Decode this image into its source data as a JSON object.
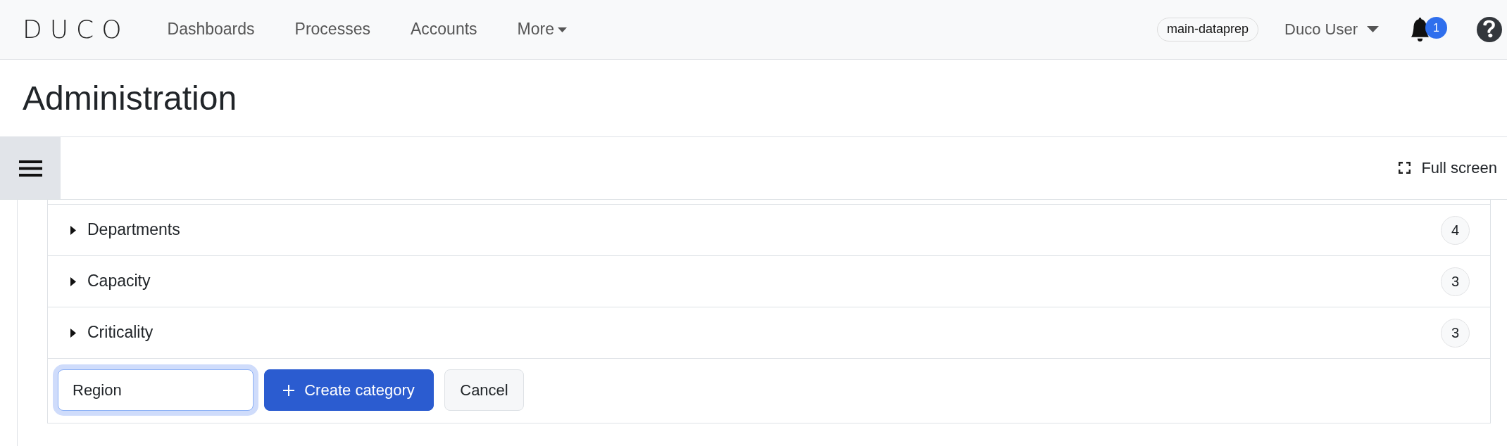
{
  "navbar": {
    "logo": "DUCO",
    "links": [
      {
        "label": "Dashboards",
        "kind": "link"
      },
      {
        "label": "Processes",
        "kind": "link"
      },
      {
        "label": "Accounts",
        "kind": "link"
      },
      {
        "label": "More",
        "kind": "dropdown"
      }
    ],
    "environment": "main-dataprep",
    "user": "Duco User",
    "notifications": "1"
  },
  "page": {
    "title": "Administration"
  },
  "toolbar": {
    "full_screen": "Full screen"
  },
  "categories": [
    {
      "name": "Departments",
      "count": "4",
      "expanded": false
    },
    {
      "name": "Capacity",
      "count": "3",
      "expanded": false
    },
    {
      "name": "Criticality",
      "count": "3",
      "expanded": false
    }
  ],
  "new_category": {
    "value": "Region",
    "focused": true,
    "create_button": "Create category",
    "cancel_button": "Cancel"
  }
}
